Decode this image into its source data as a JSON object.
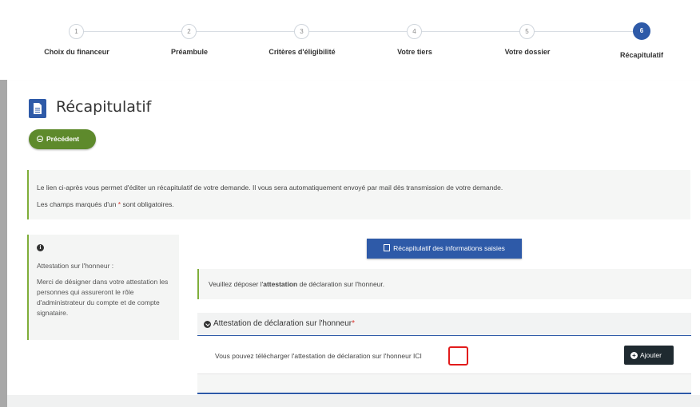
{
  "stepper": {
    "steps": [
      {
        "num": "1",
        "label": "Choix du financeur"
      },
      {
        "num": "2",
        "label": "Préambule"
      },
      {
        "num": "3",
        "label": "Critères d'éligibilité"
      },
      {
        "num": "4",
        "label": "Votre tiers"
      },
      {
        "num": "5",
        "label": "Votre dossier"
      },
      {
        "num": "6",
        "label": "Récapitulatif"
      }
    ]
  },
  "page": {
    "title": "Récapitulatif",
    "prev_label": "Précédent"
  },
  "info": {
    "line1": "Le lien ci-après vous permet d'éditer un récapitulatif de votre demande. Il vous sera automatiquement envoyé par mail dès transmission de votre demande.",
    "line2_pre": "Les champs marqués d'un ",
    "line2_star": "*",
    "line2_post": " sont obligatoires."
  },
  "side": {
    "heading": "Attestation sur l'honneur :",
    "body": "Merci de désigner dans votre attestation les personnes qui assureront le rôle d'administrateur du compte et de compte signataire."
  },
  "recap_button": "Récapitulatif des informations saisies",
  "deposit": {
    "pre": "Veuillez déposer l'",
    "bold": "attestation",
    "post": " de déclaration sur l'honneur."
  },
  "attestation": {
    "title": "Attestation de déclaration sur l'honneur",
    "star": "*",
    "text": "Vous pouvez télécharger l'attestation de déclaration sur l'honneur ICI",
    "add_label": "Ajouter"
  }
}
